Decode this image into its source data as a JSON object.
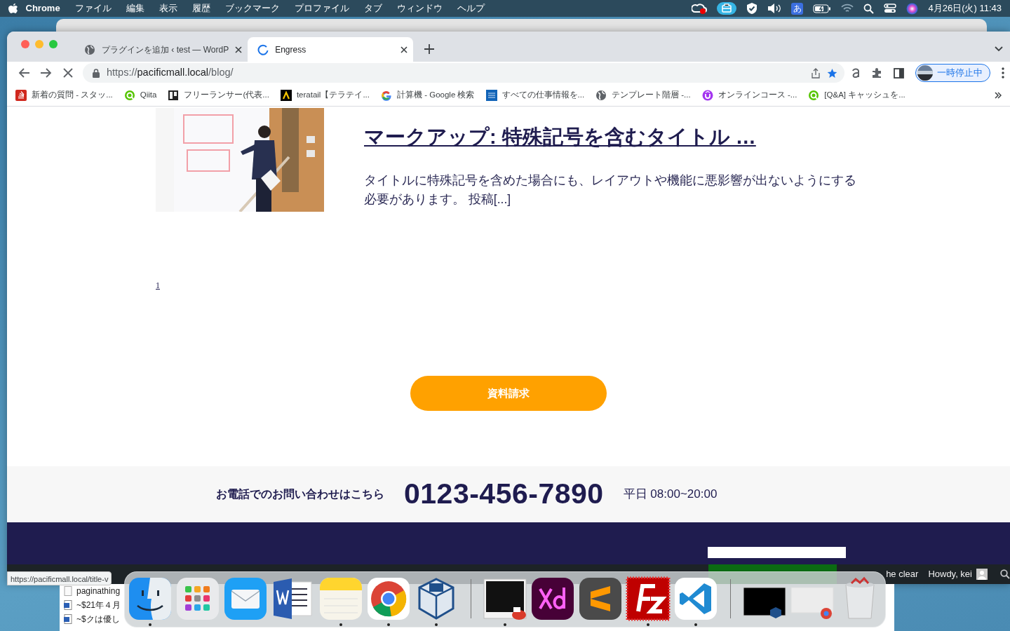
{
  "menubar": {
    "app": "Chrome",
    "menus": [
      "ファイル",
      "編集",
      "表示",
      "履歴",
      "ブックマーク",
      "プロファイル",
      "タブ",
      "ウィンドウ",
      "ヘルプ"
    ],
    "input_mode": "あ",
    "clock": "4月26日(火) 11:43"
  },
  "browser": {
    "tabs": [
      {
        "title": "プラグインを追加 ‹ test — WordP",
        "selected": false,
        "loading": false
      },
      {
        "title": "Engress",
        "selected": true,
        "loading": true
      }
    ],
    "url": {
      "scheme": "https://",
      "host": "pacificmall.local",
      "path": "/blog/"
    },
    "bookmarked": true,
    "profile": "一時停止中",
    "bookmarks": [
      {
        "kind": "stack",
        "title": "新着の質問 - スタッ..."
      },
      {
        "kind": "qiita",
        "title": "Qiita"
      },
      {
        "kind": "board",
        "title": "フリーランサー(代表..."
      },
      {
        "kind": "teratail",
        "title": "teratail【テラテイ..."
      },
      {
        "kind": "google",
        "title": "計算機 - Google 検索"
      },
      {
        "kind": "cw",
        "title": "すべての仕事情報を..."
      },
      {
        "kind": "globe",
        "title": "テンプレート階層 -..."
      },
      {
        "kind": "udemy",
        "title": "オンラインコース -..."
      },
      {
        "kind": "qiita",
        "title": "[Q&A] キャッシュを..."
      }
    ]
  },
  "page": {
    "post": {
      "title": "マークアップ: 特殊記号を含むタイトル …",
      "excerpt": "タイトルに特殊記号を含めた場合にも、レイアウトや機能に悪影響が出ないようにする必要があります。 投稿[...]"
    },
    "pagination": [
      "1"
    ],
    "cta": "資料請求",
    "contact": {
      "label": "お電話でのお問い合わせはこちら",
      "phone": "0123-456-7890",
      "hours": "平日 08:00~20:00"
    }
  },
  "admin_bar": {
    "items": [
      "he clear",
      "Howdy, kei"
    ]
  },
  "status_url": "https://pacificmall.local/title-v",
  "finder_rows": [
    {
      "kind": "blank",
      "name": "paginathing"
    },
    {
      "kind": "word",
      "name": "~$21年４月"
    },
    {
      "kind": "word",
      "name": "~$クは優し"
    }
  ],
  "dock": [
    {
      "kind": "finder",
      "running": true
    },
    {
      "kind": "launchpad",
      "running": false
    },
    {
      "kind": "mail",
      "running": false
    },
    {
      "kind": "word",
      "running": false
    },
    {
      "kind": "notes",
      "running": true
    },
    {
      "kind": "chrome",
      "running": true
    },
    {
      "kind": "virtualbox",
      "running": true
    },
    {
      "kind": "separator"
    },
    {
      "kind": "screen",
      "running": true
    },
    {
      "kind": "xd",
      "running": false
    },
    {
      "kind": "sublime",
      "running": false
    },
    {
      "kind": "filezilla",
      "running": true
    },
    {
      "kind": "vscode",
      "running": true
    },
    {
      "kind": "separator"
    },
    {
      "kind": "thumb-dark",
      "running": false
    },
    {
      "kind": "thumb-light",
      "running": false
    },
    {
      "kind": "trash",
      "running": false
    }
  ]
}
